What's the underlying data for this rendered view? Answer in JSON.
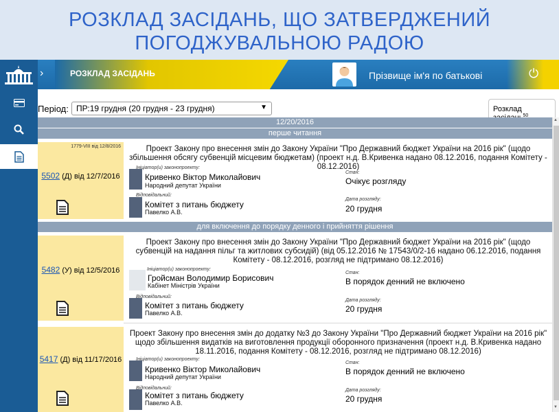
{
  "banner": {
    "line1": "РОЗКЛАД ЗАСІДАНЬ, ЩО ЗАТВЕРДЖЕНИЙ",
    "line2": "ПОГОДЖУВАЛЬНОЮ РАДОЮ"
  },
  "topbar": {
    "section_title": "РОЗКЛАД ЗАСІДАНЬ",
    "user_name": "Прізвище ім'я по батькові",
    "chevron": "›",
    "power_icon": "⏻"
  },
  "colors": {
    "banner_text": "#2e63c9",
    "topbar_blue": "#1c6aa8",
    "card_yellow": "#fbe8a0",
    "bar_gray": "#8fa2b8",
    "link_blue": "#1a55b5"
  },
  "sidebar": {
    "items": [
      {
        "icon": "card-icon"
      },
      {
        "icon": "search-icon"
      },
      {
        "icon": "document-icon"
      }
    ]
  },
  "filter": {
    "period_label": "Період:",
    "period_value": "ПР:19 грудня (20 грудня - 23 грудня)"
  },
  "tab": {
    "label": "Розклад засідань",
    "count": "50"
  },
  "date_header": "12/20/2016",
  "groups": [
    {
      "label": "перше читання",
      "items": [
        {
          "note": "1779-VIII від 12/8/2016",
          "number": "5502",
          "type": "(Д)",
          "date_text": "від 12/7/2016",
          "title": "Проект Закону про внесення змін до Закону України \"Про Державний бюджет України на 2016 рік\" (щодо збільшення обсягу субвенцій місцевим бюджетам) (проект н.д. В.Кривенка надано 08.12.2016, подання Комітету - 08.12.2016)",
          "initiator_label": "Ініціатор(и) законопроекту:",
          "initiator_name": "Кривенко Віктор Миколайович",
          "initiator_sub": "Народний депутат України",
          "status_label": "Стан:",
          "status": "Очікує розгляду",
          "responsible_label": "Відповідальний:",
          "responsible_name": "Комітет з питань бюджету",
          "responsible_sub": "Павелко А.В.",
          "date_label": "Дата розгляду:",
          "review_date": "20 грудня"
        }
      ]
    },
    {
      "label": "для включення до порядку денного і прийняття рішення",
      "items": [
        {
          "number": "5482",
          "type": "(У)",
          "date_text": "від 12/5/2016",
          "title": "Проект Закону про внесення змін до Закону України \"Про Державний бюджет України на 2016 рік\" (щодо субвенцій на надання пільг та житлових субсидій) (від 05.12.2016 № 17543/0/2-16 надано 06.12.2016, подання Комітету - 08.12.2016, розгляд не підтримано 08.12.2016)",
          "initiator_label": "Ініціатор(и) законопроекту:",
          "initiator_name": "Гройсман Володимир Борисович",
          "initiator_sub": "Кабінет Міністрів України",
          "status_label": "Стан:",
          "status": "В порядок денний не включено",
          "responsible_label": "Відповідальний:",
          "responsible_name": "Комітет з питань бюджету",
          "responsible_sub": "Павелко А.В.",
          "date_label": "Дата розгляду:",
          "review_date": "20 грудня"
        },
        {
          "number": "5417",
          "type": "(Д)",
          "date_text": "від 11/17/2016",
          "title": "Проект Закону про внесення змін до додатку №3 до Закону України \"Про Державний бюджет України на 2016 рік\" щодо збільшення видатків на виготовлення продукції оборонного призначення (проект н.д. В.Кривенка надано 18.11.2016, подання Комітету - 08.12.2016, розгляд не підтримано 08.12.2016)",
          "initiator_label": "Ініціатор(и) законопроекту:",
          "initiator_name": "Кривенко Віктор Миколайович",
          "initiator_sub": "Народний депутат України",
          "status_label": "Стан:",
          "status": "В порядок денний не включено",
          "responsible_label": "Відповідальний:",
          "responsible_name": "Комітет з питань бюджету",
          "responsible_sub": "Павелко А.В.",
          "date_label": "Дата розгляду:",
          "review_date": "20 грудня"
        }
      ]
    }
  ]
}
